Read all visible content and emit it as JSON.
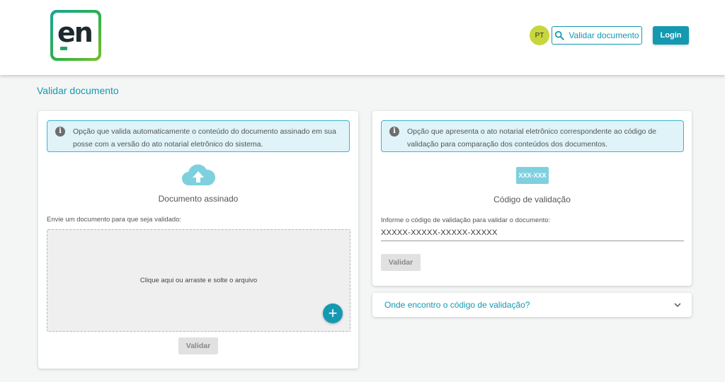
{
  "header": {
    "logo_text": "en",
    "language": "PT",
    "validar_button": "Validar documento",
    "login_button": "Login"
  },
  "page": {
    "title": "Validar documento"
  },
  "left_card": {
    "info_icon": "info-icon",
    "info_text": "Opção que valida automaticamente o conteúdo do documento assinado em sua posse com a versão do ato notarial eletrônico do sistema.",
    "section_icon": "cloud-upload-icon",
    "section_label": "Documento assinado",
    "hint": "Envie um documento para que seja validado:",
    "dropzone_text": "Clique aqui ou arraste e solte o arquivo",
    "add_symbol": "+",
    "validate_button": "Validar"
  },
  "right_card": {
    "info_icon": "info-icon",
    "info_text": "Opção que apresenta o ato notarial eletrônico correspondente ao código de validação para comparação dos conteúdos dos documentos.",
    "code_badge": "XXX-XXX",
    "section_label": "Código de validação",
    "hint": "Informe o código de validação para validar o documento:",
    "code_value": "XXXXX-XXXXX-XXXXX-XXXXX",
    "validate_button": "Validar"
  },
  "faq": {
    "title": "Onde encontro o código de validação?",
    "icon": "chevron-down-icon"
  },
  "colors": {
    "accent": "#1499b1",
    "info_bg": "#dff3f8",
    "lang_badge": "#c7d63a"
  }
}
